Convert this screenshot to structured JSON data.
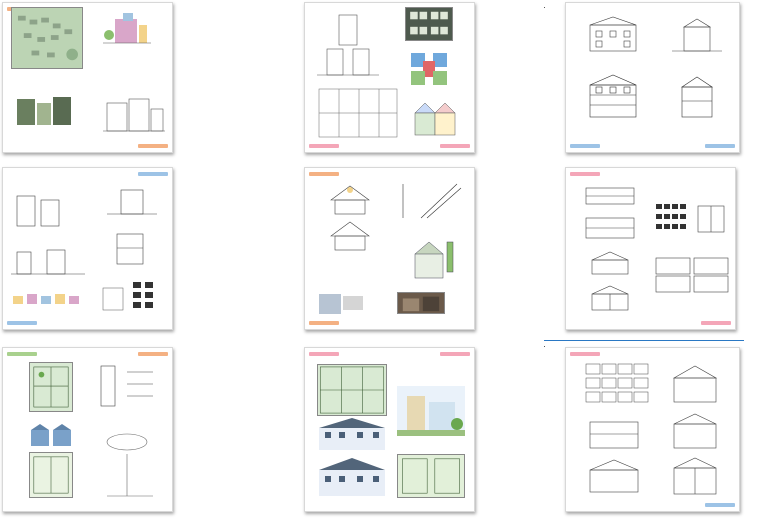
{
  "colors": {
    "tag_orange": "#f4b183",
    "tag_blue": "#9dc3e6",
    "tag_pink": "#f4a6b8",
    "tag_green": "#a9d18e",
    "selection": "#2a78c4",
    "plan_red": "#e06666",
    "plan_blue": "#6fa8dc",
    "plan_green": "#93c47d"
  },
  "pages": [
    {
      "id": "p1",
      "tags": [
        "orange",
        "orange"
      ]
    },
    {
      "id": "p2",
      "tags": [
        "pink",
        "pink"
      ]
    },
    {
      "id": "p3",
      "tags": [
        "blue",
        "blue"
      ]
    },
    {
      "id": "p4",
      "tags": [
        "blue",
        "blue"
      ]
    },
    {
      "id": "p5",
      "tags": [
        "orange",
        "orange"
      ]
    },
    {
      "id": "p6",
      "tags": [
        "pink",
        "pink"
      ]
    },
    {
      "id": "p7",
      "tags": [
        "green",
        "orange"
      ]
    },
    {
      "id": "p8",
      "tags": [
        "pink",
        "pink"
      ]
    },
    {
      "id": "p9",
      "tags": [
        "pink",
        "blue"
      ]
    }
  ]
}
